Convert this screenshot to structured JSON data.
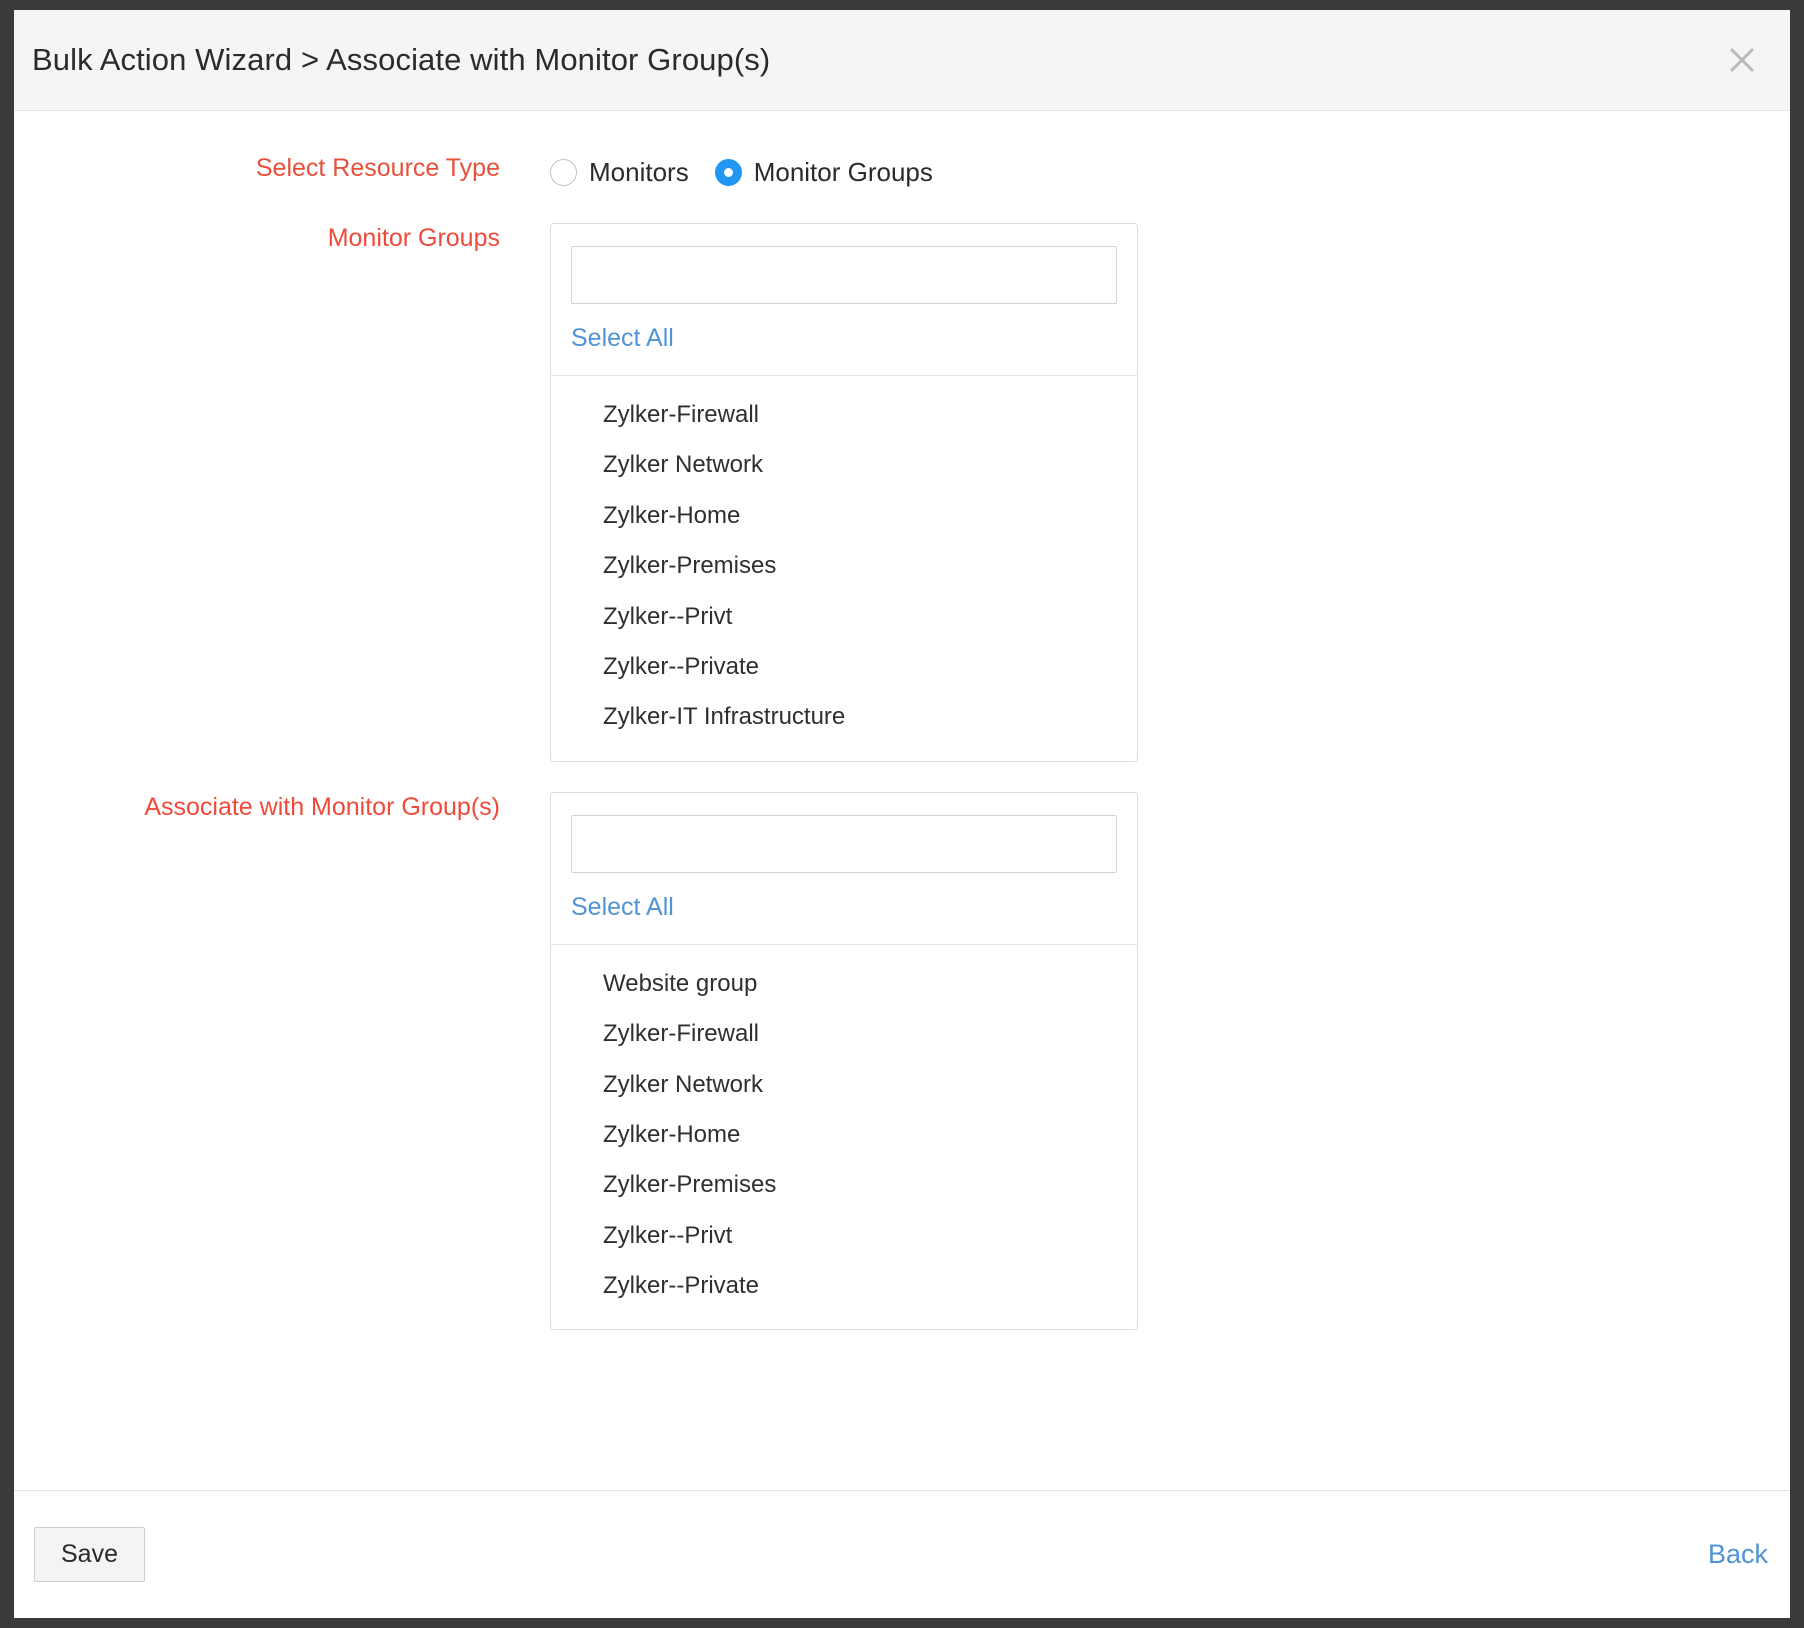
{
  "header": {
    "title": "Bulk Action Wizard > Associate with Monitor Group(s)",
    "close_icon": "close-icon"
  },
  "colors": {
    "label_red": "#ef4a3a",
    "link_blue": "#5193d4",
    "radio_accent": "#2196f3",
    "header_bg": "#f5f5f5",
    "border": "#dcdcdc"
  },
  "resource_type": {
    "label": "Select Resource Type",
    "options": [
      {
        "label": "Monitors",
        "selected": false
      },
      {
        "label": "Monitor Groups",
        "selected": true
      }
    ]
  },
  "monitor_groups": {
    "label": "Monitor Groups",
    "search_value": "",
    "search_placeholder": "",
    "select_all_label": "Select All",
    "items": [
      "Zylker-Firewall",
      "Zylker Network",
      "Zylker-Home",
      "Zylker-Premises",
      "Zylker--Privt",
      "Zylker--Private",
      "Zylker-IT Infrastructure"
    ]
  },
  "associate_groups": {
    "label": "Associate with Monitor Group(s)",
    "search_value": "",
    "search_placeholder": "",
    "select_all_label": "Select All",
    "items": [
      "Website group",
      "Zylker-Firewall",
      "Zylker Network",
      "Zylker-Home",
      "Zylker-Premises",
      "Zylker--Privt",
      "Zylker--Private"
    ]
  },
  "footer": {
    "save_label": "Save",
    "back_label": "Back"
  }
}
